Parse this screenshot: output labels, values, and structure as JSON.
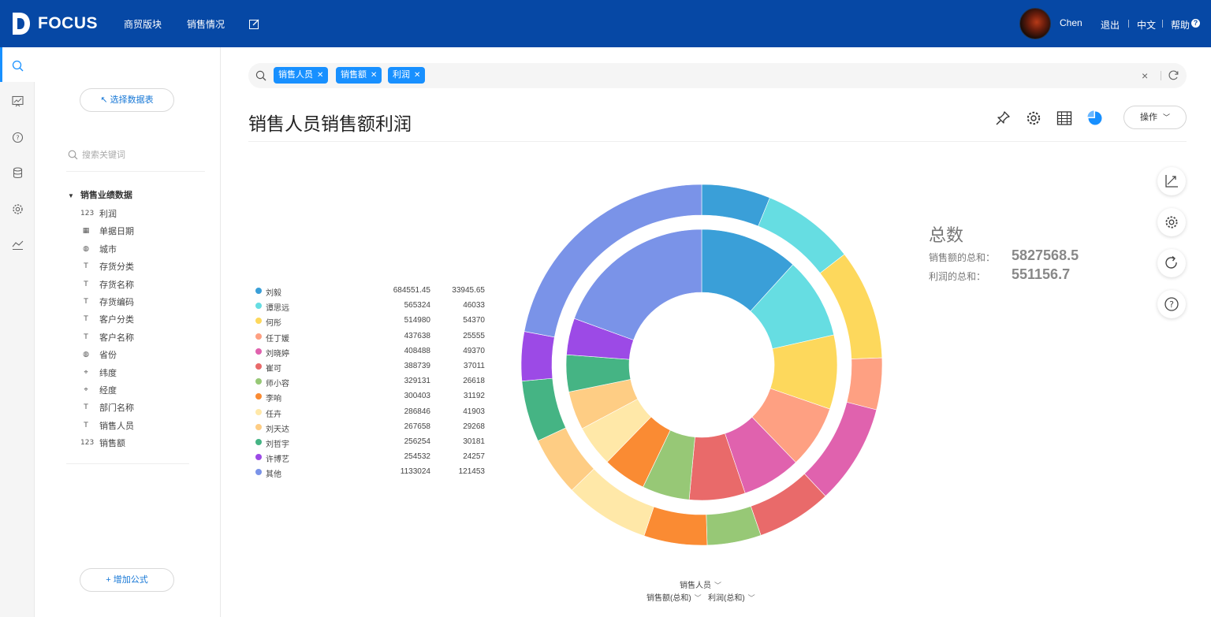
{
  "header": {
    "logo_text": "FOCUS",
    "nav": [
      "商贸版块",
      "销售情况"
    ],
    "user_name": "Chen",
    "logout": "退出",
    "language": "中文",
    "help": "帮助"
  },
  "panel": {
    "select_table": "↖ 选择数据表",
    "search_placeholder": "搜索关键词",
    "group_title": "销售业绩数据",
    "fields": [
      {
        "icon": "123",
        "label": "利润"
      },
      {
        "icon": "▦",
        "label": "单据日期"
      },
      {
        "icon": "◍",
        "label": "城市"
      },
      {
        "icon": "T",
        "label": "存货分类"
      },
      {
        "icon": "T",
        "label": "存货名称"
      },
      {
        "icon": "T",
        "label": "存货编码"
      },
      {
        "icon": "T",
        "label": "客户分类"
      },
      {
        "icon": "T",
        "label": "客户名称"
      },
      {
        "icon": "◍",
        "label": "省份"
      },
      {
        "icon": "⌖",
        "label": "纬度"
      },
      {
        "icon": "⌖",
        "label": "经度"
      },
      {
        "icon": "T",
        "label": "部门名称"
      },
      {
        "icon": "T",
        "label": "销售人员"
      },
      {
        "icon": "123",
        "label": "销售额"
      }
    ],
    "add_formula": "+ 增加公式"
  },
  "search": {
    "chips": [
      "销售人员",
      "销售额",
      "利润"
    ]
  },
  "main": {
    "title": "销售人员销售额利润",
    "operate": "操作"
  },
  "totals": {
    "title": "总数",
    "sales_label": "销售额的总和：",
    "sales_value": "5827568.5",
    "profit_label": "利润的总和：",
    "profit_value": "551156.7"
  },
  "axis": {
    "dimension": "销售人员",
    "measure1": "销售额(总和)",
    "measure2": "利润(总和)"
  },
  "colors": {
    "brand": "#0648a5",
    "accent": "#1890ff"
  },
  "chart_data": {
    "type": "pie",
    "subtype": "nested-donut",
    "inner_series": "销售额(总和)",
    "outer_series": "利润(总和)",
    "categories": [
      "刘毅",
      "谭思远",
      "何彤",
      "任丁媛",
      "刘晓婷",
      "崔可",
      "师小容",
      "李响",
      "任卉",
      "刘天达",
      "刘哲宇",
      "许博艺",
      "其他"
    ],
    "series": [
      {
        "name": "销售额(总和)",
        "values": [
          684551.45,
          565324,
          514980,
          437638,
          408488,
          388739,
          329131,
          300403,
          286846,
          267658,
          256254,
          254532,
          1133024
        ]
      },
      {
        "name": "利润(总和)",
        "values": [
          33945.65,
          46033,
          54370,
          25555,
          49370,
          37011,
          26618,
          31192,
          41903,
          29268,
          30181,
          24257,
          121453
        ]
      }
    ],
    "legend_values": {
      "sales": [
        "684551.45",
        "565324",
        "514980",
        "437638",
        "408488",
        "388739",
        "329131",
        "300403",
        "286846",
        "267658",
        "256254",
        "254532",
        "1133024"
      ],
      "profit": [
        "33945.65",
        "46033",
        "54370",
        "25555",
        "49370",
        "37011",
        "26618",
        "31192",
        "41903",
        "29268",
        "30181",
        "24257",
        "121453"
      ]
    },
    "colors": [
      "#3a9fd8",
      "#66dde2",
      "#fdd85c",
      "#fea082",
      "#e062ae",
      "#e96a6a",
      "#97c876",
      "#fa8b33",
      "#ffe8a8",
      "#fecd84",
      "#45b484",
      "#9c4ae6",
      "#7a93e8"
    ],
    "legend_position": "left"
  }
}
